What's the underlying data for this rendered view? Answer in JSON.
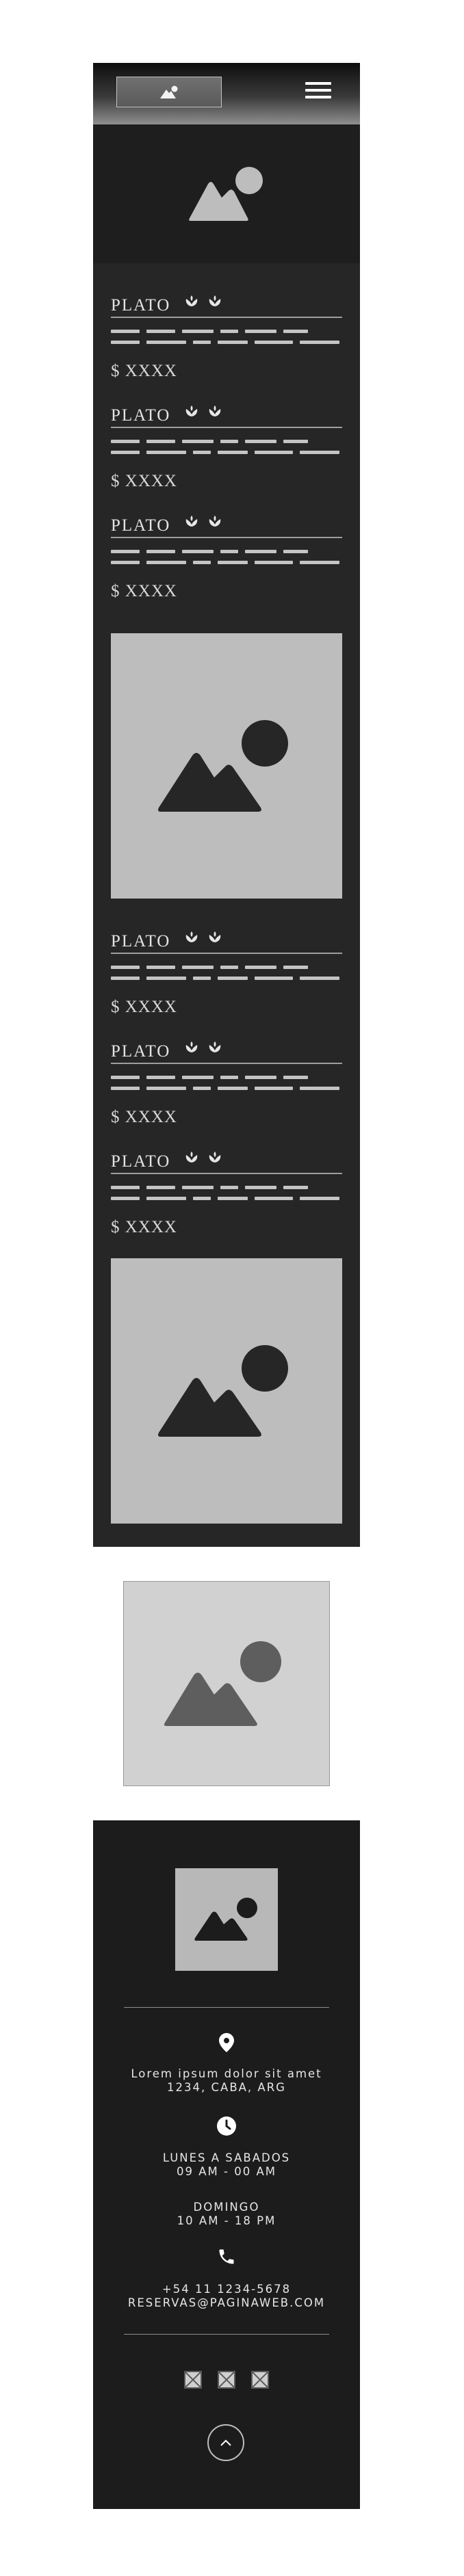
{
  "header": {
    "logo_icon": "image-placeholder-icon",
    "menu_icon": "hamburger-menu-icon"
  },
  "hero": {
    "image_icon": "image-placeholder-icon"
  },
  "menu": {
    "group_a": [
      {
        "name": "PLATO",
        "price": "$ XXXX",
        "tag_icons": [
          "leaf-icon",
          "leaf-icon"
        ]
      },
      {
        "name": "PLATO",
        "price": "$ XXXX",
        "tag_icons": [
          "leaf-icon",
          "leaf-icon"
        ]
      },
      {
        "name": "PLATO",
        "price": "$ XXXX",
        "tag_icons": [
          "leaf-icon",
          "leaf-icon"
        ]
      }
    ],
    "group_b": [
      {
        "name": "PLATO",
        "price": "$ XXXX",
        "tag_icons": [
          "leaf-icon",
          "leaf-icon"
        ]
      },
      {
        "name": "PLATO",
        "price": "$ XXXX",
        "tag_icons": [
          "leaf-icon",
          "leaf-icon"
        ]
      },
      {
        "name": "PLATO",
        "price": "$ XXXX",
        "tag_icons": [
          "leaf-icon",
          "leaf-icon"
        ]
      }
    ]
  },
  "footer": {
    "address_line1": "Lorem ipsum dolor sit amet",
    "address_line2": "1234, CABA, ARG",
    "hours_weekdays_label": "LUNES A SABADOS",
    "hours_weekdays_time": "09 AM - 00 AM",
    "hours_sunday_label": "DOMINGO",
    "hours_sunday_time": "10 AM - 18 PM",
    "phone": "+54 11 1234-5678",
    "email": "RESERVAS@PAGINAWEB.COM",
    "social_icons": [
      "social-placeholder-icon",
      "social-placeholder-icon",
      "social-placeholder-icon"
    ],
    "back_to_top_icon": "chevron-up-icon"
  },
  "colors": {
    "frame_bg": "#262626",
    "footer_bg": "#1c1c1c",
    "placeholder_gray": "#bdbdbd",
    "text_light": "#e3e3e3"
  }
}
